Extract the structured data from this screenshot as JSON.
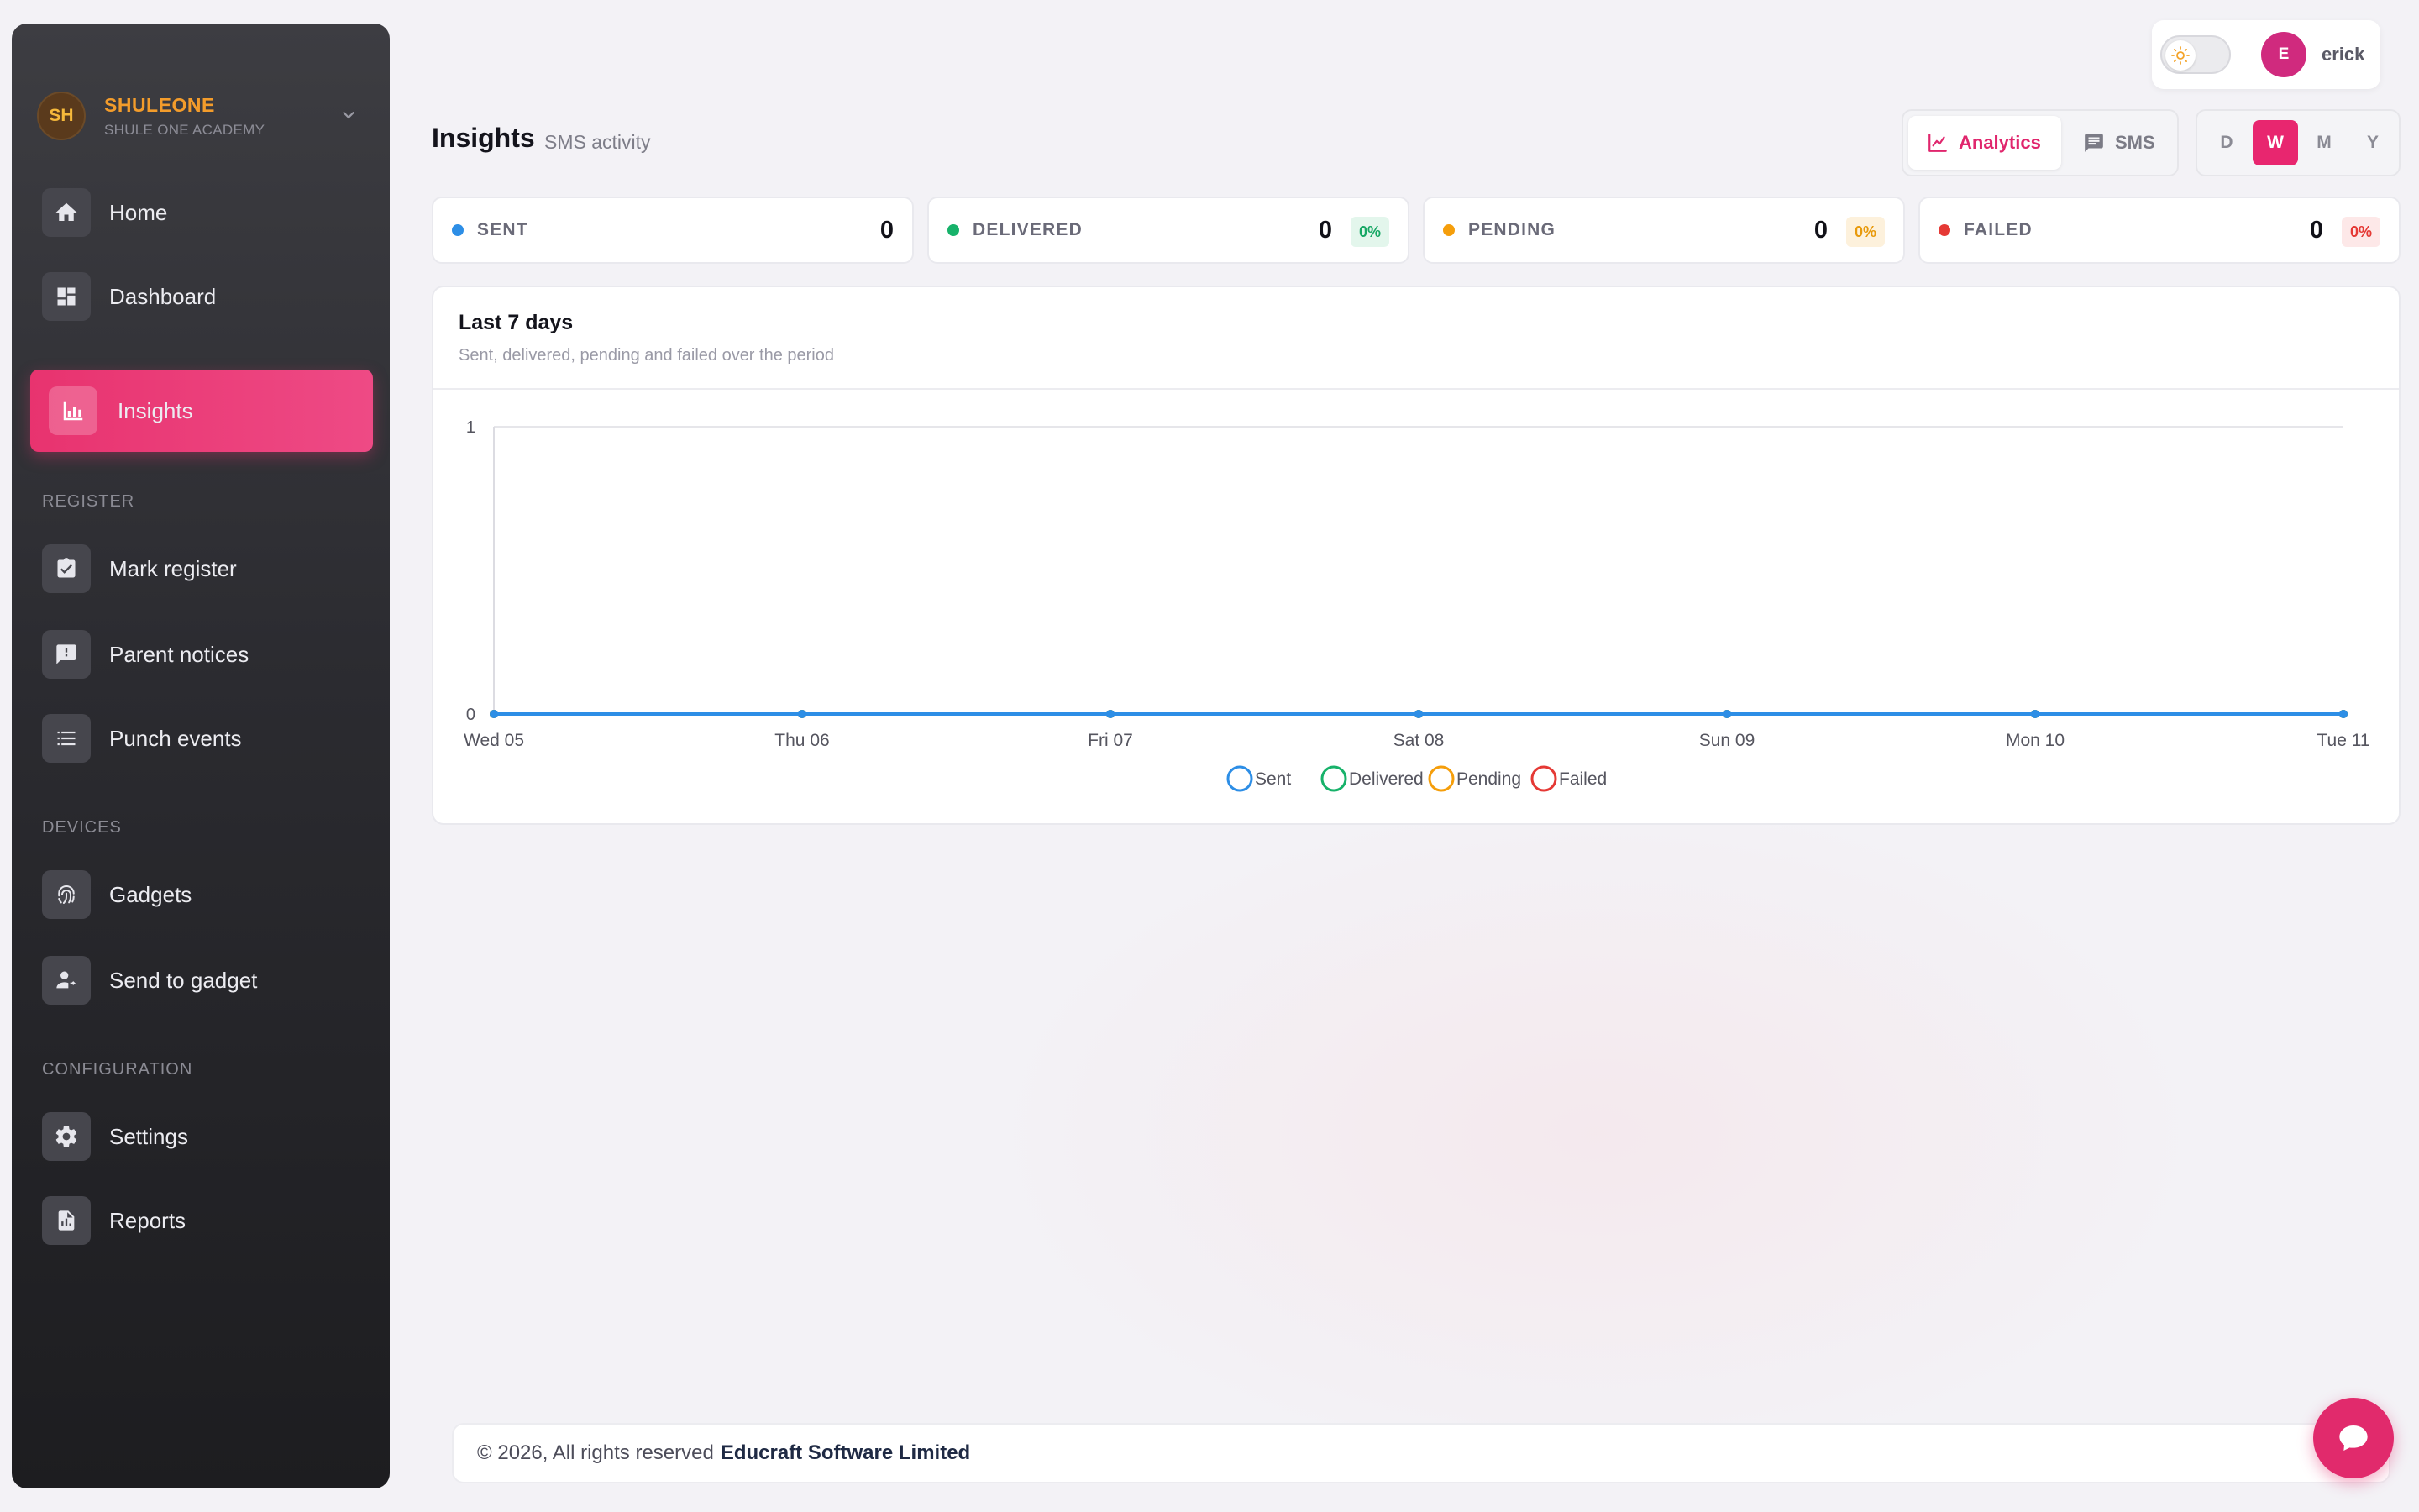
{
  "brand": {
    "initials": "SH",
    "name": "SHULEONE",
    "subtitle": "SHULE ONE ACADEMY"
  },
  "sidebar": {
    "items": [
      {
        "label": "Home",
        "icon": "home-icon"
      },
      {
        "label": "Dashboard",
        "icon": "dashboard-icon"
      },
      {
        "label": "Insights",
        "icon": "bar-chart-icon",
        "active": true
      },
      {
        "label": "Mark register",
        "icon": "clipboard-check-icon"
      },
      {
        "label": "Parent notices",
        "icon": "alert-message-icon"
      },
      {
        "label": "Punch events",
        "icon": "list-icon"
      },
      {
        "label": "Gadgets",
        "icon": "fingerprint-icon"
      },
      {
        "label": "Send to gadget",
        "icon": "user-send-icon"
      },
      {
        "label": "Settings",
        "icon": "gear-icon"
      },
      {
        "label": "Reports",
        "icon": "report-file-icon"
      }
    ],
    "sections": {
      "register": "REGISTER",
      "devices": "DEVICES",
      "configuration": "CONFIGURATION"
    }
  },
  "user": {
    "initial": "E",
    "name": "erick"
  },
  "header": {
    "title": "Insights",
    "subtitle": "SMS activity"
  },
  "view_switch": {
    "analytics": "Analytics",
    "sms": "SMS"
  },
  "period_switch": {
    "d": "D",
    "w": "W",
    "m": "M",
    "y": "Y",
    "selected": "W"
  },
  "stats": [
    {
      "name": "SENT",
      "value": "0",
      "pct": "",
      "color": "#2d8ee6"
    },
    {
      "name": "DELIVERED",
      "value": "0",
      "pct": "0%",
      "color": "#17b26a"
    },
    {
      "name": "PENDING",
      "value": "0",
      "pct": "0%",
      "color": "#f59e0b"
    },
    {
      "name": "FAILED",
      "value": "0",
      "pct": "0%",
      "color": "#e53935"
    }
  ],
  "chart": {
    "title": "Last 7 days",
    "description": "Sent, delivered, pending and failed over the period"
  },
  "chart_data": {
    "type": "line",
    "categories": [
      "Wed 05",
      "Thu 06",
      "Fri 07",
      "Sat 08",
      "Sun 09",
      "Mon 10",
      "Tue 11"
    ],
    "series": [
      {
        "name": "Sent",
        "values": [
          0,
          0,
          0,
          0,
          0,
          0,
          0
        ],
        "color": "#2d8ee6"
      },
      {
        "name": "Delivered",
        "values": [
          0,
          0,
          0,
          0,
          0,
          0,
          0
        ],
        "color": "#17b26a"
      },
      {
        "name": "Pending",
        "values": [
          0,
          0,
          0,
          0,
          0,
          0,
          0
        ],
        "color": "#f59e0b"
      },
      {
        "name": "Failed",
        "values": [
          0,
          0,
          0,
          0,
          0,
          0,
          0
        ],
        "color": "#e53935"
      }
    ],
    "ylim": [
      0,
      1
    ],
    "yticks": [
      "0",
      "1"
    ],
    "legend": "bottom-center",
    "grid": true
  },
  "footer": {
    "text": "© 2026, All rights reserved",
    "company": "Educraft Software Limited"
  }
}
